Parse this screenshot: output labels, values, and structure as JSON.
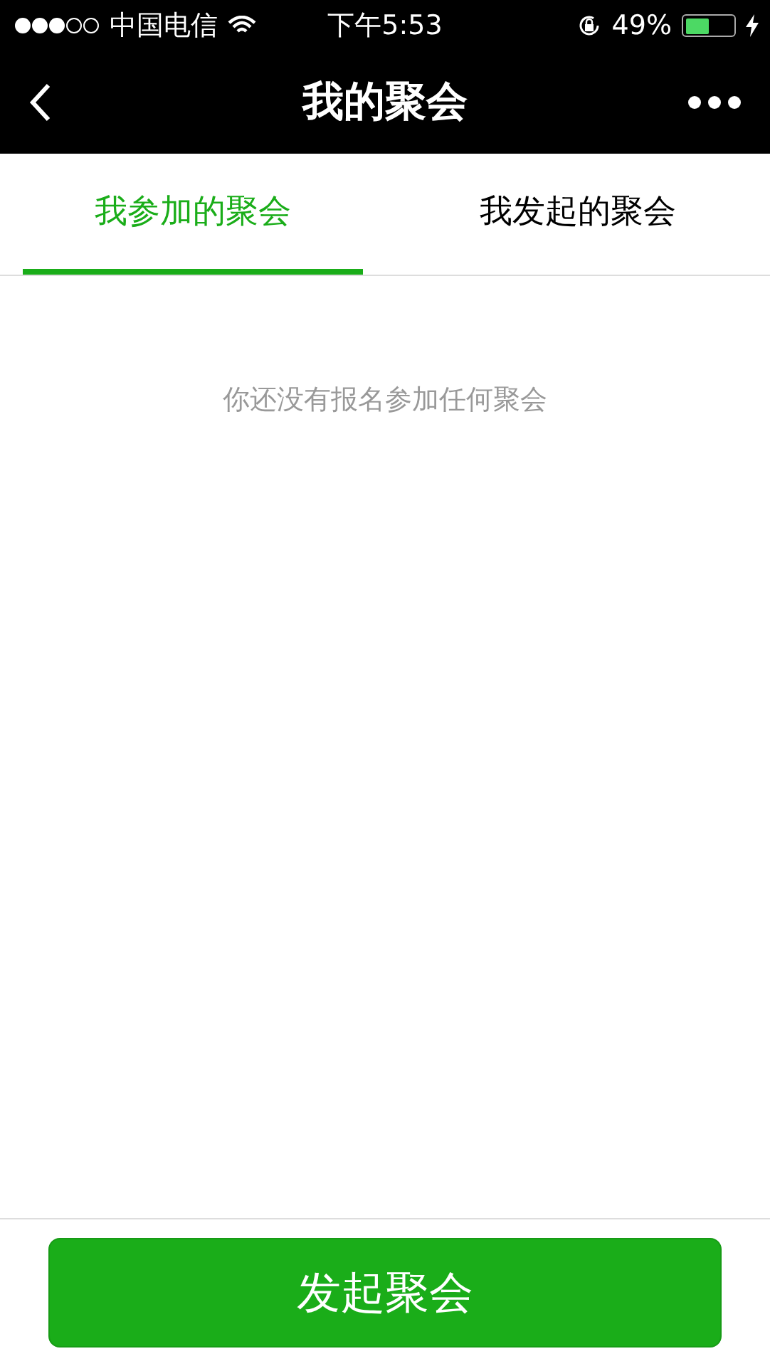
{
  "status_bar": {
    "carrier": "中国电信",
    "time": "下午5:53",
    "battery_percent": "49%",
    "battery": {
      "level": 0.49
    }
  },
  "nav_bar": {
    "title": "我的聚会"
  },
  "tabs": [
    {
      "label": "我参加的聚会",
      "selected": true
    },
    {
      "label": "我发起的聚会",
      "selected": false
    }
  ],
  "empty_message": "你还没有报名参加任何聚会",
  "primary_button": "发起聚会"
}
